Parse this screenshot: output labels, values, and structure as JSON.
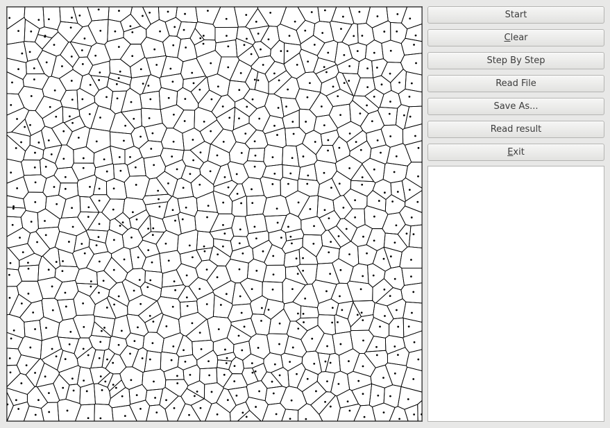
{
  "canvas": {
    "description": "voronoi-diagram",
    "background": "#ffffff",
    "edge_color": "#000000",
    "site_color": "#000000"
  },
  "buttons": [
    {
      "key": "start",
      "pre": "",
      "mnemonic": "",
      "post": "Start"
    },
    {
      "key": "clear",
      "pre": "",
      "mnemonic": "C",
      "post": "lear"
    },
    {
      "key": "step-by-step",
      "pre": "",
      "mnemonic": "",
      "post": "Step By Step"
    },
    {
      "key": "read-file",
      "pre": "",
      "mnemonic": "",
      "post": "Read File"
    },
    {
      "key": "save-as",
      "pre": "",
      "mnemonic": "",
      "post": "Save As..."
    },
    {
      "key": "read-result",
      "pre": "",
      "mnemonic": "",
      "post": "Read result"
    },
    {
      "key": "exit",
      "pre": "",
      "mnemonic": "E",
      "post": "xit"
    }
  ],
  "output_log": {
    "text": ""
  }
}
